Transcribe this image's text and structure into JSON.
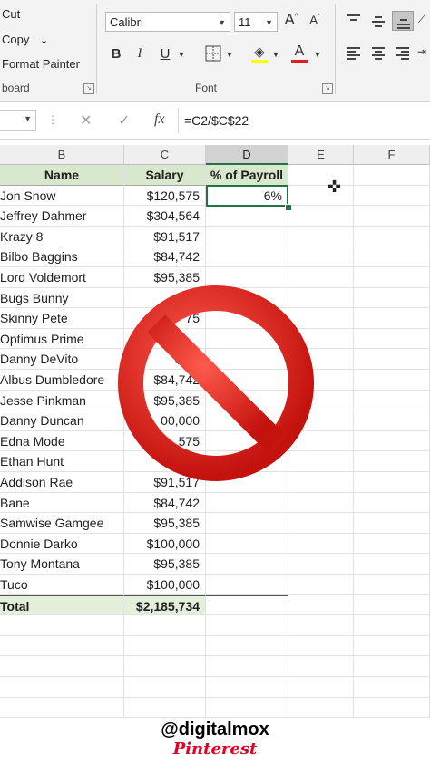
{
  "ribbon": {
    "clipboard": {
      "cut": "Cut",
      "copy": "Copy",
      "copy_chevron": "⌄",
      "format_painter": "Format Painter",
      "group_label": "board"
    },
    "font": {
      "font_name": "Calibri",
      "font_size": "11",
      "group_label": "Font",
      "bold": "B",
      "italic": "I",
      "underline": "U",
      "grow": "A",
      "shrink": "A"
    },
    "alignment": {}
  },
  "formula_bar": {
    "cancel": "✕",
    "enter": "✓",
    "fx": "fx",
    "formula": "=C2/$C$22"
  },
  "columns": [
    "B",
    "C",
    "D",
    "E",
    "F"
  ],
  "table": {
    "headers": [
      "Name",
      "Salary",
      "% of Payroll"
    ],
    "rows": [
      {
        "name": "Jon Snow",
        "salary": "$120,575",
        "pct": "6%"
      },
      {
        "name": "Jeffrey Dahmer",
        "salary": "$304,564",
        "pct": ""
      },
      {
        "name": "Krazy 8",
        "salary": "$91,517",
        "pct": ""
      },
      {
        "name": "Bilbo Baggins",
        "salary": "$84,742",
        "pct": ""
      },
      {
        "name": "Lord Voldemort",
        "salary": "$95,385",
        "pct": ""
      },
      {
        "name": "Bugs Bunny",
        "salary": "$10",
        "pct": ""
      },
      {
        "name": "Skinny Pete",
        "salary": "75",
        "pct": ""
      },
      {
        "name": "Optimus Prime",
        "salary": "",
        "pct": ""
      },
      {
        "name": "Danny DeVito",
        "salary": "$91,",
        "pct": ""
      },
      {
        "name": "Albus Dumbledore",
        "salary": "$84,742",
        "pct": ""
      },
      {
        "name": "Jesse Pinkman",
        "salary": "$95,385",
        "pct": ""
      },
      {
        "name": "Danny Duncan",
        "salary": "00,000",
        "pct": ""
      },
      {
        "name": "Edna Mode",
        "salary": "575",
        "pct": ""
      },
      {
        "name": "Ethan Hunt",
        "salary": "$10",
        "pct": ""
      },
      {
        "name": "Addison Rae",
        "salary": "$91,517",
        "pct": ""
      },
      {
        "name": "Bane",
        "salary": "$84,742",
        "pct": ""
      },
      {
        "name": "Samwise Gamgee",
        "salary": "$95,385",
        "pct": ""
      },
      {
        "name": "Donnie Darko",
        "salary": "$100,000",
        "pct": ""
      },
      {
        "name": "Tony Montana",
        "salary": "$95,385",
        "pct": ""
      },
      {
        "name": "Tuco",
        "salary": "$100,000",
        "pct": ""
      }
    ],
    "total": {
      "label": "Total",
      "salary": "$2,185,734"
    }
  },
  "overlay": {
    "icon": "prohibited-sign",
    "color": "#e8231c"
  },
  "credits": {
    "handle": "@digitalmox",
    "brand": "Pinterest"
  },
  "colors": {
    "excel_green": "#217346",
    "header_fill": "#d8e8cc",
    "total_fill": "#e2efda"
  }
}
